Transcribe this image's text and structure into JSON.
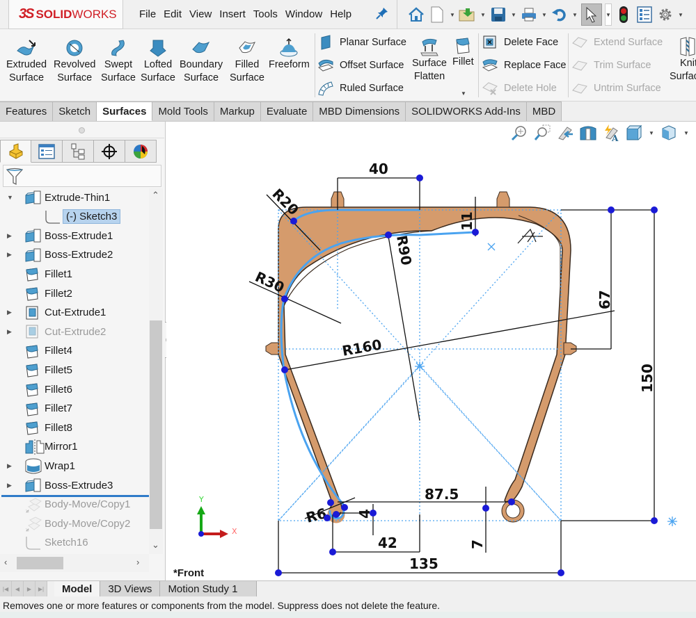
{
  "app": {
    "logo_prefix": "3S",
    "logo_bold": "SOLID",
    "logo_light": "WORKS"
  },
  "menu": [
    "File",
    "Edit",
    "View",
    "Insert",
    "Tools",
    "Window",
    "Help"
  ],
  "quick_access": [
    {
      "name": "home-icon"
    },
    {
      "name": "new-document-icon",
      "dropdown": true
    },
    {
      "name": "open-folder-icon",
      "dropdown": true
    },
    {
      "name": "save-icon",
      "dropdown": true
    },
    {
      "name": "print-icon",
      "dropdown": true
    },
    {
      "name": "undo-icon",
      "dropdown": true
    },
    {
      "name": "select-pointer-icon",
      "dropdown": true,
      "selected": true
    },
    {
      "name": "rebuild-traffic-light-icon"
    },
    {
      "name": "file-properties-icon"
    },
    {
      "name": "options-gear-icon",
      "dropdown": true
    }
  ],
  "ribbon": {
    "big_buttons": [
      {
        "line1": "Extruded",
        "line2": "Surface"
      },
      {
        "line1": "Revolved",
        "line2": "Surface"
      },
      {
        "line1": "Swept",
        "line2": "Surface"
      },
      {
        "line1": "Lofted",
        "line2": "Surface"
      },
      {
        "line1": "Boundary",
        "line2": "Surface"
      },
      {
        "line1": "Filled",
        "line2": "Surface"
      },
      {
        "line1": "Freeform",
        "line2": ""
      }
    ],
    "group2": [
      "Planar Surface",
      "Offset Surface",
      "Ruled Surface"
    ],
    "surface_flatten": {
      "line1": "Surface",
      "line2": "Flatten"
    },
    "fillet": "Fillet",
    "group3": [
      "Delete Face",
      "Replace Face",
      "Delete Hole"
    ],
    "group3_disabled": [
      false,
      false,
      true
    ],
    "group4": [
      "Extend Surface",
      "Trim Surface",
      "Untrim Surface"
    ],
    "knit": {
      "line1": "Knit",
      "line2": "Surface"
    }
  },
  "command_tabs": [
    "Features",
    "Sketch",
    "Surfaces",
    "Mold Tools",
    "Markup",
    "Evaluate",
    "MBD Dimensions",
    "SOLIDWORKS Add-Ins",
    "MBD"
  ],
  "active_command_tab": "Surfaces",
  "feature_tree": [
    {
      "label": "Extrude-Thin1",
      "expander": "open",
      "icon": "extrude-icon"
    },
    {
      "label": "(-) Sketch3",
      "expander": "none",
      "icon": "sketch-icon",
      "selected": true,
      "child": true
    },
    {
      "label": "Boss-Extrude1",
      "expander": "closed",
      "icon": "extrude-icon"
    },
    {
      "label": "Boss-Extrude2",
      "expander": "closed",
      "icon": "extrude-icon"
    },
    {
      "label": "Fillet1",
      "expander": "none",
      "icon": "fillet-icon"
    },
    {
      "label": "Fillet2",
      "expander": "none",
      "icon": "fillet-icon"
    },
    {
      "label": "Cut-Extrude1",
      "expander": "closed",
      "icon": "cut-extrude-icon"
    },
    {
      "label": "Cut-Extrude2",
      "expander": "closed",
      "icon": "cut-extrude-icon",
      "suppressed": true
    },
    {
      "label": "Fillet4",
      "expander": "none",
      "icon": "fillet-icon"
    },
    {
      "label": "Fillet5",
      "expander": "none",
      "icon": "fillet-icon"
    },
    {
      "label": "Fillet6",
      "expander": "none",
      "icon": "fillet-icon"
    },
    {
      "label": "Fillet7",
      "expander": "none",
      "icon": "fillet-icon"
    },
    {
      "label": "Fillet8",
      "expander": "none",
      "icon": "fillet-icon"
    },
    {
      "label": "Mirror1",
      "expander": "none",
      "icon": "mirror-icon"
    },
    {
      "label": "Wrap1",
      "expander": "closed",
      "icon": "wrap-icon"
    },
    {
      "label": "Boss-Extrude3",
      "expander": "closed",
      "icon": "extrude-icon"
    },
    {
      "label": "Body-Move/Copy1",
      "expander": "none",
      "icon": "body-move-icon",
      "suppressed": true
    },
    {
      "label": "Body-Move/Copy2",
      "expander": "none",
      "icon": "body-move-icon",
      "suppressed": true
    },
    {
      "label": "Sketch16",
      "expander": "none",
      "icon": "sketch-icon",
      "suppressed": true
    }
  ],
  "viewport": {
    "view_label": "*Front",
    "triad": {
      "x": "X",
      "y": "Y"
    },
    "dimensions": {
      "top_width": "40",
      "thickness": "11",
      "r20": "R20",
      "r90": "R90",
      "r30": "R30",
      "r160": "R160",
      "height_67": "67",
      "height_150": "150",
      "width_87_5": "87.5",
      "r6": "R6",
      "small_4": "4",
      "offset_42": "42",
      "offset_7": "7",
      "width_135": "135"
    }
  },
  "bottom_tabs": [
    "Model",
    "3D Views",
    "Motion Study 1"
  ],
  "active_bottom_tab": "Model",
  "status": "Removes one or more features or components from the model. Suppress does not delete the feature."
}
